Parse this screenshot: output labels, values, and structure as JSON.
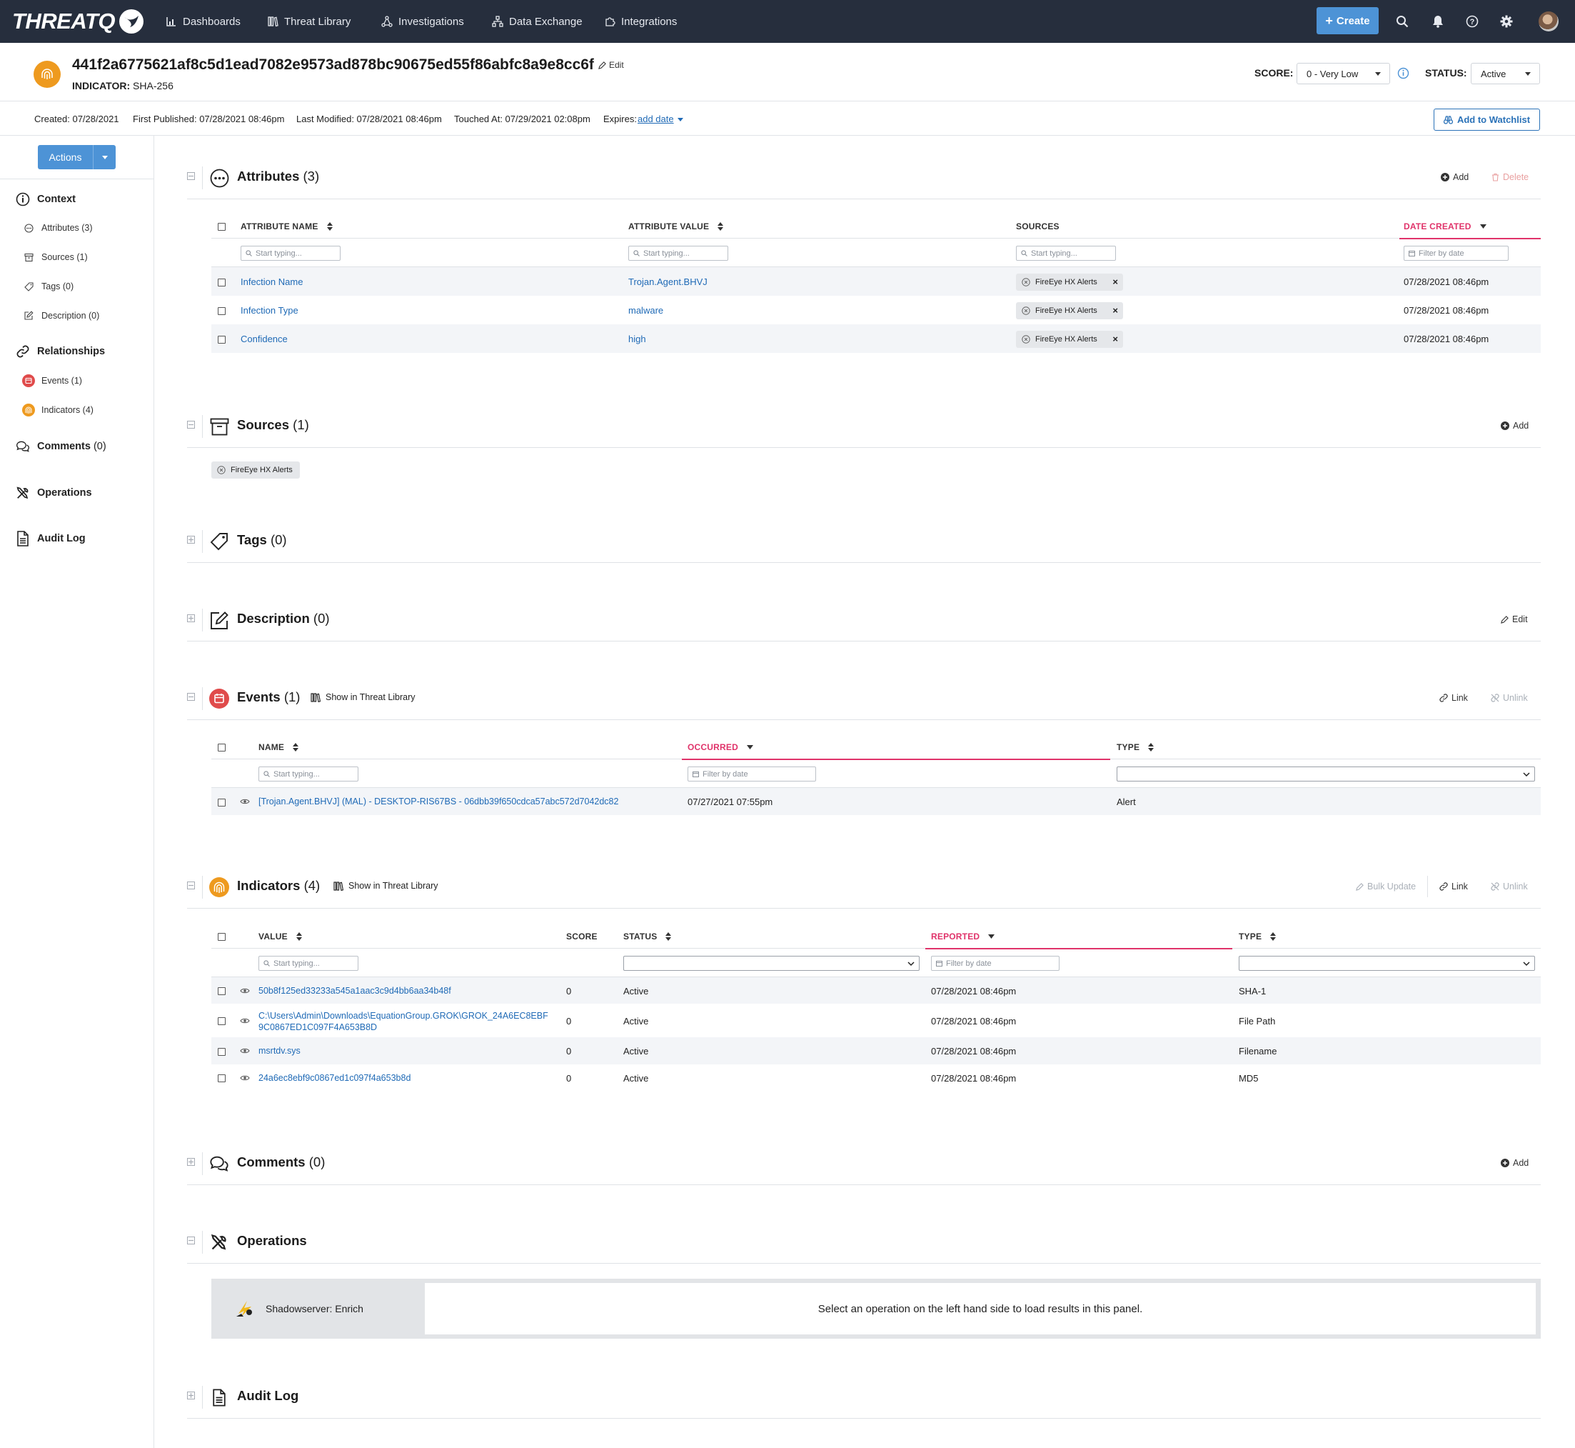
{
  "nav": {
    "logo": "THREATQ",
    "items": [
      {
        "label": "Dashboards",
        "icon": "bar-chart-icon"
      },
      {
        "label": "Threat Library",
        "icon": "library-icon"
      },
      {
        "label": "Investigations",
        "icon": "network-icon"
      },
      {
        "label": "Data Exchange",
        "icon": "sitemap-icon"
      },
      {
        "label": "Integrations",
        "icon": "puzzle-icon"
      }
    ],
    "create_label": "Create",
    "icons": [
      "search-icon",
      "bell-icon",
      "help-icon",
      "gear-icon",
      "avatar"
    ]
  },
  "header": {
    "title": "441f2a6775621af8c5d1ead7082e9573ad878bc90675ed55f86abfc8a9e8cc6f",
    "edit_label": "Edit",
    "indicator_label": "INDICATOR:",
    "indicator_type": "SHA-256",
    "score_label": "SCORE:",
    "score_value": "0 - Very Low",
    "status_label": "STATUS:",
    "status_value": "Active"
  },
  "meta": {
    "created": "Created: 07/28/2021",
    "first_published": "First Published: 07/28/2021 08:46pm",
    "last_modified": "Last Modified: 07/28/2021 08:46pm",
    "touched_at": "Touched At: 07/29/2021 02:08pm",
    "expires_label": "Expires:",
    "expires_link": "add date",
    "watchlist_label": "Add to Watchlist"
  },
  "sidebar": {
    "actions_label": "Actions",
    "context": "Context",
    "context_items": [
      "Attributes (3)",
      "Sources (1)",
      "Tags (0)",
      "Description (0)"
    ],
    "relationships": "Relationships",
    "relationship_items": [
      "Events (1)",
      "Indicators (4)"
    ],
    "comments": "Comments",
    "comments_count": "(0)",
    "operations": "Operations",
    "audit_log": "Audit Log"
  },
  "filter_placeholder": "Start typing...",
  "date_placeholder": "Filter by date",
  "attributes": {
    "title": "Attributes",
    "count": "(3)",
    "add_label": "Add",
    "delete_label": "Delete",
    "columns": [
      "ATTRIBUTE NAME",
      "ATTRIBUTE VALUE",
      "SOURCES",
      "DATE CREATED"
    ],
    "rows": [
      {
        "name": "Infection Name",
        "value": "Trojan.Agent.BHVJ",
        "source": "FireEye HX Alerts",
        "date": "07/28/2021 08:46pm"
      },
      {
        "name": "Infection Type",
        "value": "malware",
        "source": "FireEye HX Alerts",
        "date": "07/28/2021 08:46pm"
      },
      {
        "name": "Confidence",
        "value": "high",
        "source": "FireEye HX Alerts",
        "date": "07/28/2021 08:46pm"
      }
    ]
  },
  "sources": {
    "title": "Sources",
    "count": "(1)",
    "add_label": "Add",
    "chip": "FireEye HX Alerts"
  },
  "tags": {
    "title": "Tags",
    "count": "(0)"
  },
  "description": {
    "title": "Description",
    "count": "(0)",
    "edit_label": "Edit"
  },
  "events": {
    "title": "Events",
    "count": "(1)",
    "show_label": "Show in Threat Library",
    "link_label": "Link",
    "unlink_label": "Unlink",
    "columns": [
      "NAME",
      "OCCURRED",
      "TYPE"
    ],
    "rows": [
      {
        "name": "[Trojan.Agent.BHVJ] (MAL) - DESKTOP-RIS67BS - 06dbb39f650cdca57abc572d7042dc82",
        "occurred": "07/27/2021 07:55pm",
        "type": "Alert"
      }
    ]
  },
  "indicators": {
    "title": "Indicators",
    "count": "(4)",
    "show_label": "Show in Threat Library",
    "bulk_label": "Bulk Update",
    "link_label": "Link",
    "unlink_label": "Unlink",
    "columns": [
      "VALUE",
      "SCORE",
      "STATUS",
      "REPORTED",
      "TYPE"
    ],
    "rows": [
      {
        "value": "50b8f125ed33233a545a1aac3c9d4bb6aa34b48f",
        "value2": "",
        "score": "0",
        "status": "Active",
        "reported": "07/28/2021 08:46pm",
        "type": "SHA-1"
      },
      {
        "value": "C:\\Users\\Admin\\Downloads\\EquationGroup.GROK\\GROK_24A6EC8EBF",
        "value2": "9C0867ED1C097F4A653B8D",
        "score": "0",
        "status": "Active",
        "reported": "07/28/2021 08:46pm",
        "type": "File Path"
      },
      {
        "value": "msrtdv.sys",
        "value2": "",
        "score": "0",
        "status": "Active",
        "reported": "07/28/2021 08:46pm",
        "type": "Filename"
      },
      {
        "value": "24a6ec8ebf9c0867ed1c097f4a653b8d",
        "value2": "",
        "score": "0",
        "status": "Active",
        "reported": "07/28/2021 08:46pm",
        "type": "MD5"
      }
    ]
  },
  "comments": {
    "title": "Comments",
    "count": "(0)",
    "add_label": "Add"
  },
  "operations": {
    "title": "Operations",
    "operation_name": "Shadowserver: Enrich",
    "panel_message": "Select an operation on the left hand side to load results in this panel."
  },
  "audit": {
    "title": "Audit Log"
  },
  "colors": {
    "nav_bg": "#262e3d",
    "accent": "#4d93d6",
    "link": "#1f6ab6",
    "active_sort": "#e0336a",
    "indicator_orange": "#ee9a1f",
    "event_red": "#e04b4b"
  }
}
